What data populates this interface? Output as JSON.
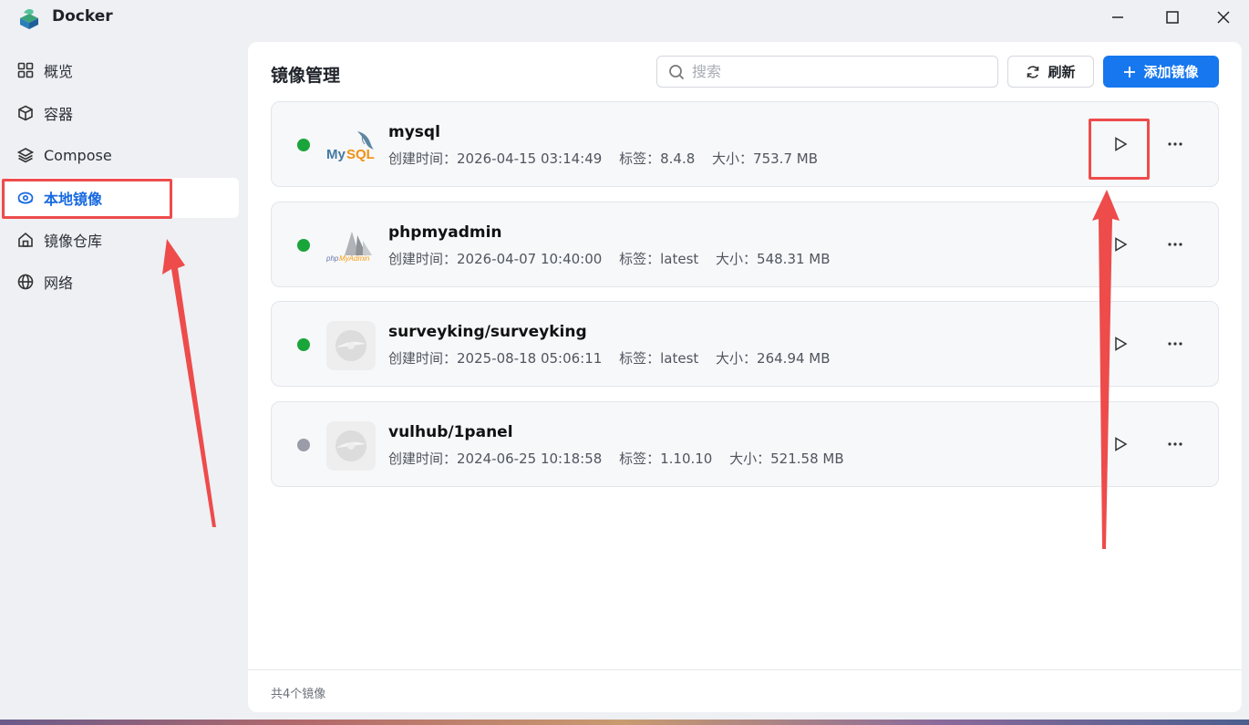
{
  "window": {
    "title": "Docker"
  },
  "sidebar": {
    "items": [
      {
        "label": "概览",
        "icon": "grid-icon"
      },
      {
        "label": "容器",
        "icon": "cube-icon"
      },
      {
        "label": "Compose",
        "icon": "layers-icon"
      },
      {
        "label": "本地镜像",
        "icon": "disc-icon",
        "active": true
      },
      {
        "label": "镜像仓库",
        "icon": "home-icon"
      },
      {
        "label": "网络",
        "icon": "globe-icon"
      }
    ]
  },
  "main": {
    "title": "镜像管理",
    "search_placeholder": "搜索",
    "refresh_label": "刷新",
    "add_label": "添加镜像",
    "footer": "共4个镜像"
  },
  "images": [
    {
      "name": "mysql",
      "created": "创建时间：2026-04-15 03:14:49",
      "tag": "标签：8.4.8",
      "size": "大小：753.7 MB",
      "status_color": "#1aa53b",
      "logo": "MySQL"
    },
    {
      "name": "phpmyadmin",
      "created": "创建时间：2026-04-07 10:40:00",
      "tag": "标签：latest",
      "size": "大小：548.31 MB",
      "status_color": "#1aa53b",
      "logo": "phpMyAdmin"
    },
    {
      "name": "surveyking/surveyking",
      "created": "创建时间：2025-08-18 05:06:11",
      "tag": "标签：latest",
      "size": "大小：264.94 MB",
      "status_color": "#1aa53b",
      "logo": "disc-icon"
    },
    {
      "name": "vulhub/1panel",
      "created": "创建时间：2024-06-25 10:18:58",
      "tag": "标签：1.10.10",
      "size": "大小：521.58 MB",
      "status_color": "#9a9ca8",
      "logo": "disc-icon"
    }
  ],
  "colors": {
    "accent": "#1677ee",
    "annotation": "#ee4b4b"
  }
}
